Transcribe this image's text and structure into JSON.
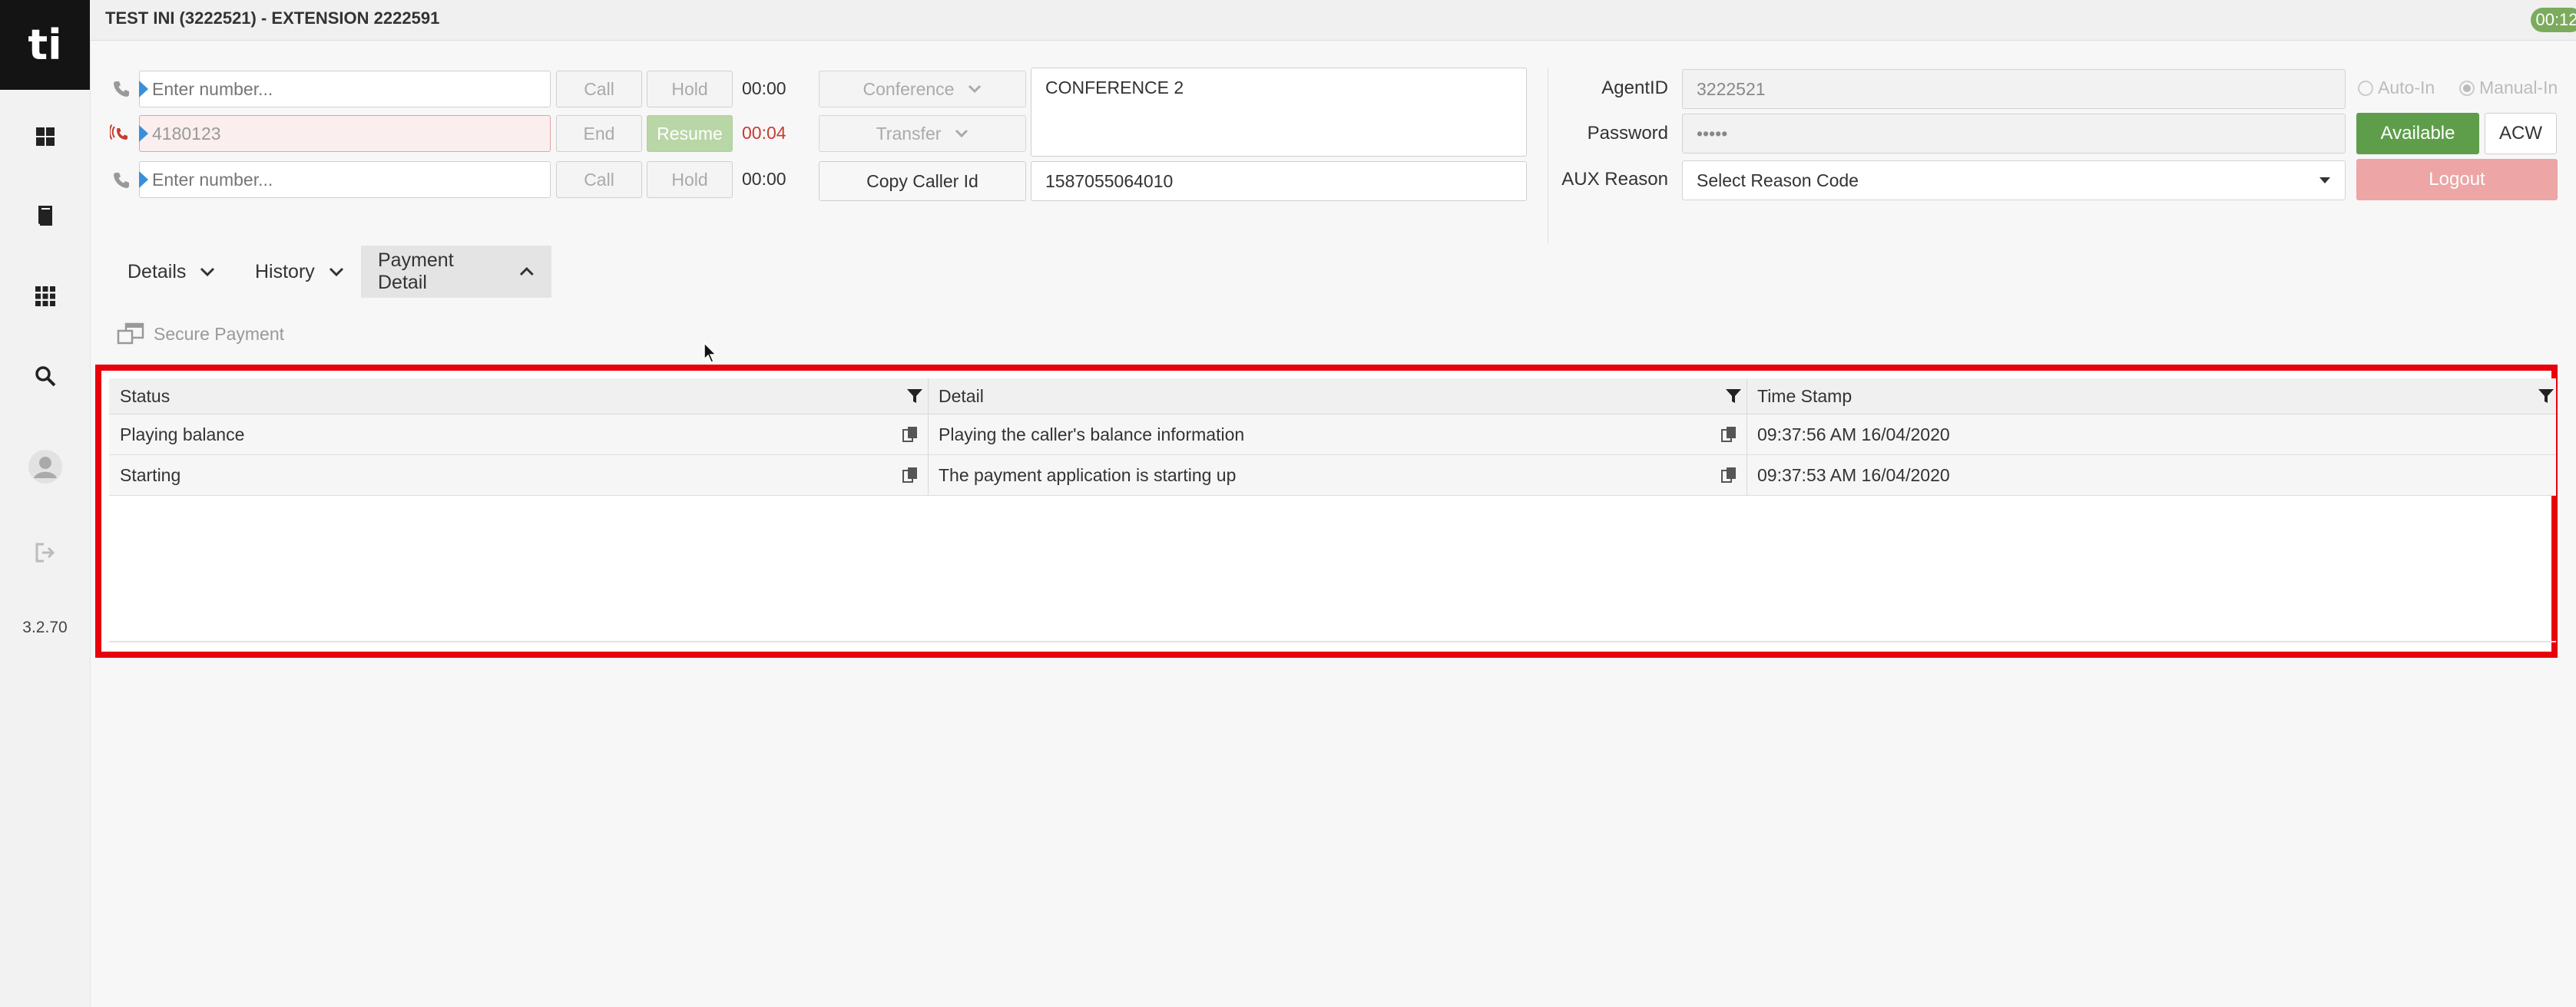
{
  "sidebar": {
    "logo_text": "ti",
    "icons": [
      "dashboard-icon",
      "book-icon",
      "apps-icon",
      "search-icon",
      "avatar-icon",
      "sign-out-icon"
    ],
    "version": "3.2.70"
  },
  "titlebar": {
    "title": "TEST INI (3222521) - EXTENSION 2222591",
    "timer": "00:12"
  },
  "lines": [
    {
      "placeholder": "Enter number...",
      "value": "",
      "btn1": "Call",
      "btn2": "Hold",
      "time": "00:00"
    },
    {
      "placeholder": "",
      "value": "4180123",
      "btn1": "End",
      "btn2": "Resume",
      "time": "00:04"
    },
    {
      "placeholder": "Enter number...",
      "value": "",
      "btn1": "Call",
      "btn2": "Hold",
      "time": "00:00"
    }
  ],
  "controls": {
    "conference": "Conference",
    "transfer": "Transfer",
    "copy_caller_id": "Copy Caller Id",
    "conference_text": "CONFERENCE 2",
    "caller_id": "1587055064010"
  },
  "agent": {
    "agentid_label": "AgentID",
    "agentid": "3222521",
    "password_label": "Password",
    "password": "•••••",
    "aux_label": "AUX Reason",
    "aux_value": "Select Reason Code",
    "auto_in": "Auto-In",
    "manual_in": "Manual-In",
    "available": "Available",
    "acw": "ACW",
    "logout": "Logout"
  },
  "tabs": [
    {
      "label": "Details"
    },
    {
      "label": "History"
    },
    {
      "label": "Payment Detail"
    }
  ],
  "secure_payment": "Secure Payment",
  "table": {
    "columns": [
      "Status",
      "Detail",
      "Time Stamp"
    ],
    "rows": [
      [
        "Playing balance",
        "Playing the caller's balance information",
        "09:37:56 AM 16/04/2020"
      ],
      [
        "Starting",
        "The payment application is starting up",
        "09:37:53 AM 16/04/2020"
      ]
    ]
  },
  "colors": {
    "highlight_border": "#e8000d",
    "available": "#5e9e4b",
    "logout": "#eda5a5",
    "accent_blue": "#3a8fd9"
  }
}
